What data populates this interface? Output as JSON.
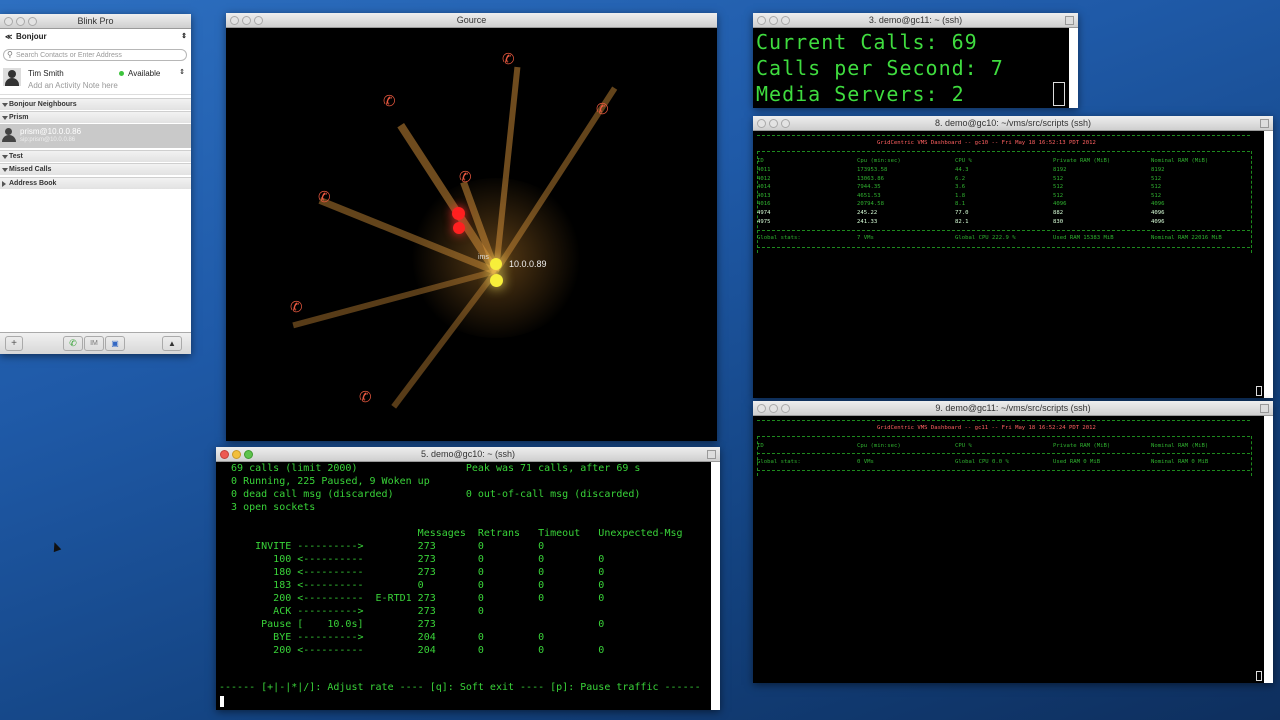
{
  "blink": {
    "title": "Blink Pro",
    "account": "Bonjour",
    "search_placeholder": "Search Contacts or Enter Address",
    "user_name": "Tim Smith",
    "presence": "Available",
    "activity_note": "Add an Activity Note here",
    "groups": [
      {
        "label": "Bonjour Neighbours",
        "open": true
      },
      {
        "label": "Prism",
        "open": true
      },
      {
        "label": "Test",
        "open": true
      },
      {
        "label": "Missed Calls",
        "open": true
      },
      {
        "label": "Address Book",
        "open": false
      }
    ],
    "prism_contact": "prism@10.0.0.86",
    "prism_contact_sub": "sip:prism@10.0.0.86",
    "toolbar": {
      "add": "+",
      "im": "IM"
    }
  },
  "gource": {
    "title": "Gource",
    "node_label": "10.0.0.89",
    "node_label_small": "ims"
  },
  "sipp": {
    "title": "5. demo@gc10: ~ (ssh)",
    "lines": [
      "  69 calls (limit 2000)                  Peak was 71 calls, after 69 s",
      "  0 Running, 225 Paused, 9 Woken up",
      "  0 dead call msg (discarded)            0 out-of-call msg (discarded)",
      "  3 open sockets",
      "",
      "                                 Messages  Retrans   Timeout   Unexpected-Msg",
      "      INVITE ---------->         273       0         0",
      "         100 <----------         273       0         0         0",
      "         180 <----------         273       0         0         0",
      "         183 <----------         0         0         0         0",
      "         200 <----------  E-RTD1 273       0         0         0",
      "         ACK ---------->         273       0",
      "       Pause [    10.0s]         273                           0",
      "         BYE ---------->         204       0         0",
      "         200 <----------         204       0         0         0",
      "",
      "------ [+|-|*|/]: Adjust rate ---- [q]: Soft exit ---- [p]: Pause traffic ------"
    ]
  },
  "calls": {
    "title": "3. demo@gc11: ~ (ssh)",
    "lines": [
      "Current Calls: 69",
      "Calls per Second: 7",
      "Media Servers: 2"
    ]
  },
  "dash1": {
    "title": "8. demo@gc10: ~/vms/src/scripts (ssh)",
    "header": "GridCentric VMS Dashboard -- gc10 -- Fri May 18 16:52:13 PDT 2012",
    "columns": [
      "ID",
      "Cpu (min:sec)",
      "CPU %",
      "Private RAM (MiB)",
      "Nominal RAM (MiB)"
    ],
    "rows": [
      [
        "4011",
        "173953.58",
        "44.3",
        "8192",
        "8192"
      ],
      [
        "4012",
        "13063.86",
        "6.2",
        "512",
        "512"
      ],
      [
        "4014",
        "7944.35",
        "3.6",
        "512",
        "512"
      ],
      [
        "4013",
        "4651.53",
        "1.8",
        "512",
        "512"
      ],
      [
        "4016",
        "20794.58",
        "8.1",
        "4096",
        "4096"
      ],
      [
        "4974",
        "245.22",
        "77.0",
        "882",
        "4096"
      ],
      [
        "4975",
        "241.33",
        "82.1",
        "830",
        "4096"
      ]
    ],
    "global": [
      "Global stats:",
      "7 VMs",
      "Global CPU 222.9 %",
      "Used RAM 15383 MiB",
      "Nominal RAM 22016 MiB"
    ]
  },
  "dash2": {
    "title": "9. demo@gc11: ~/vms/src/scripts (ssh)",
    "header": "GridCentric VMS Dashboard -- gc11 -- Fri May 18 16:52:24 PDT 2012",
    "columns": [
      "ID",
      "Cpu (min:sec)",
      "CPU %",
      "Private RAM (MiB)",
      "Nominal RAM (MiB)"
    ],
    "global": [
      "Global stats:",
      "0 VMs",
      "Global CPU 0.0 %",
      "Used RAM 0 MiB",
      "Nominal RAM 0 MiB"
    ]
  },
  "colors": {
    "terminal_green": "#3fdc3f",
    "dash_header": "#ff6060",
    "phone": "#e8583f"
  }
}
